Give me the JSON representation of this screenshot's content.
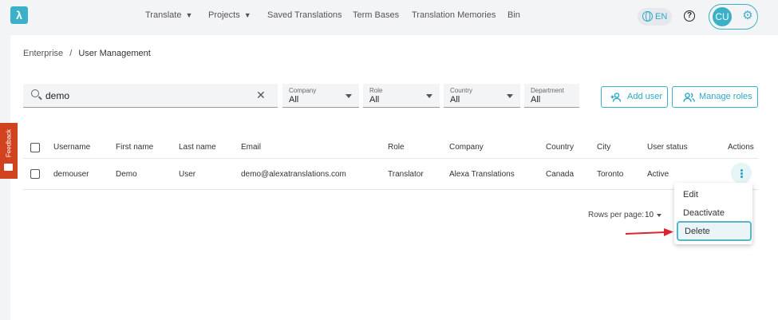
{
  "topbar": {
    "nav": [
      {
        "label": "Translate",
        "dropdown": true
      },
      {
        "label": "Projects",
        "dropdown": true
      },
      {
        "label": "Saved Translations",
        "dropdown": false
      },
      {
        "label": "Term Bases",
        "dropdown": false
      },
      {
        "label": "Translation Memories",
        "dropdown": false
      },
      {
        "label": "Bin",
        "dropdown": false
      }
    ],
    "language": "EN",
    "help_glyph": "?",
    "avatar_initials": "CU"
  },
  "breadcrumb": {
    "parent": "Enterprise",
    "separator": "/",
    "current": "User Management"
  },
  "filters": {
    "search_value": "demo",
    "selects": [
      {
        "label": "Company",
        "value": "All"
      },
      {
        "label": "Role",
        "value": "All"
      },
      {
        "label": "Country",
        "value": "All"
      },
      {
        "label": "Department",
        "value": "All"
      }
    ]
  },
  "buttons": {
    "add_user": "Add user",
    "manage_roles": "Manage roles"
  },
  "feedback": {
    "label": "Feedback"
  },
  "table": {
    "headers": [
      "Username",
      "First name",
      "Last name",
      "Email",
      "Role",
      "Company",
      "Country",
      "City",
      "User status",
      "Actions"
    ],
    "rows": [
      [
        "demouser",
        "Demo",
        "User",
        "demo@alexatranslations.com",
        "Translator",
        "Alexa Translations",
        "Canada",
        "Toronto",
        "Active"
      ]
    ]
  },
  "pagination": {
    "rows_per_page_label": "Rows per page:",
    "rows_per_page_value": "10"
  },
  "action_menu": {
    "items": [
      "Edit",
      "Deactivate",
      "Delete"
    ],
    "highlighted": "Delete"
  },
  "colors": {
    "accent": "#3bb0c9",
    "feedback": "#d0431e",
    "annotation_arrow": "#d9262f"
  }
}
